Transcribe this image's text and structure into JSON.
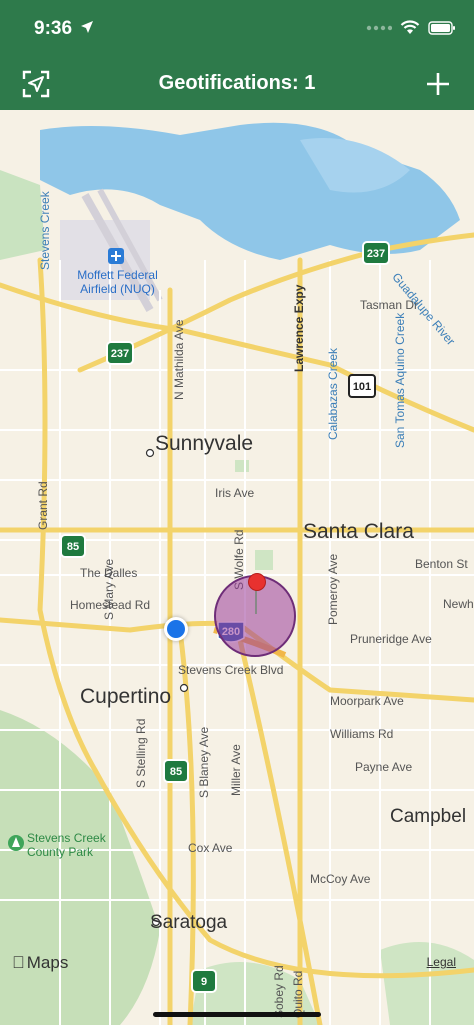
{
  "status": {
    "time": "9:36"
  },
  "nav": {
    "title": "Geotifications: 1"
  },
  "map": {
    "cities": [
      "Sunnyvale",
      "Santa Clara",
      "Cupertino",
      "Saratoga",
      "Campbel"
    ],
    "streets": [
      "Iris Ave",
      "Homestead Rd",
      "The Dalles",
      "Stevens Creek Blvd",
      "Pruneridge Ave",
      "Moorpark Ave",
      "Williams Rd",
      "Payne Ave",
      "Cox Ave",
      "McCoy Ave",
      "Benton St",
      "Tasman Dr",
      "S Mary Ave",
      "N Mathilda Ave",
      "Lawrence Expy",
      "S Wolfe Rd",
      "Pomeroy Ave",
      "Calabazas Creek",
      "San Tomas Aquino Creek",
      "Guadalupe River",
      "Stevens Creek",
      "Grant Rd",
      "S Stelling Rd",
      "S Blaney Ave",
      "Miller Ave",
      "Sobey Rd",
      "Quito Rd",
      "Newho"
    ],
    "places": [
      "Moffett Federal Airfield (NUQ)",
      "Stevens Creek County Park"
    ],
    "shields": [
      "237",
      "237",
      "101",
      "85",
      "85",
      "280",
      "9"
    ],
    "maps_brand": "Maps",
    "legal": "Legal"
  }
}
